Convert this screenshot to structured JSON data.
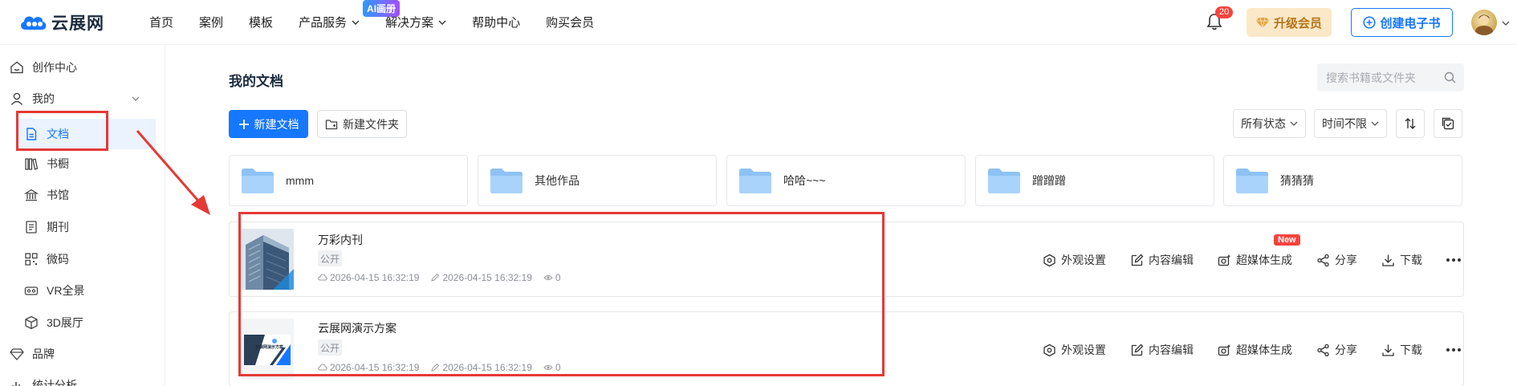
{
  "brand": {
    "name": "云展网"
  },
  "nav": {
    "items": [
      {
        "label": "首页",
        "has_dropdown": false
      },
      {
        "label": "案例",
        "has_dropdown": false
      },
      {
        "label": "模板",
        "has_dropdown": false
      },
      {
        "label": "产品服务",
        "has_dropdown": true
      },
      {
        "label": "解决方案",
        "has_dropdown": true
      },
      {
        "label": "帮助中心",
        "has_dropdown": false
      },
      {
        "label": "购买会员",
        "has_dropdown": false
      }
    ],
    "ai_badge": "AI画册"
  },
  "header": {
    "notification_count": "20",
    "upgrade_label": "升级会员",
    "create_label": "创建电子书"
  },
  "sidebar": {
    "items": [
      {
        "label": "创作中心",
        "icon": "home-icon"
      },
      {
        "label": "我的",
        "icon": "user-icon"
      },
      {
        "label": "文档",
        "icon": "document-icon"
      },
      {
        "label": "书橱",
        "icon": "bookshelf-icon"
      },
      {
        "label": "书馆",
        "icon": "library-icon"
      },
      {
        "label": "期刊",
        "icon": "journal-icon"
      },
      {
        "label": "微码",
        "icon": "qrcode-icon"
      },
      {
        "label": "VR全景",
        "icon": "vr-icon"
      },
      {
        "label": "3D展厅",
        "icon": "cube-icon"
      },
      {
        "label": "品牌",
        "icon": "diamond-icon"
      },
      {
        "label": "统计分析",
        "icon": "chart-icon"
      }
    ]
  },
  "main": {
    "title": "我的文档",
    "search_placeholder": "搜索书籍或文件夹",
    "new_doc_label": "新建文档",
    "new_folder_label": "新建文件夹",
    "status_filter": "所有状态",
    "time_filter": "时间不限",
    "folders": [
      "mmm",
      "其他作品",
      "哈哈~~~",
      "蹭蹭蹭",
      "猜猜猜"
    ],
    "documents": [
      {
        "title": "万彩内刊",
        "tag": "公开",
        "created": "2026-04-15 16:32:19",
        "updated": "2026-04-15 16:32:19",
        "views": "0",
        "thumb_caption": ""
      },
      {
        "title": "云展网演示方案",
        "tag": "公开",
        "created": "2026-04-15 16:32:19",
        "updated": "2026-04-15 16:32:19",
        "views": "0",
        "thumb_caption": "云展网演示方案"
      }
    ],
    "actions": [
      "外观设置",
      "内容编辑",
      "超媒体生成",
      "分享",
      "下载"
    ],
    "new_badge": "New"
  },
  "colors": {
    "accent": "#1677ff",
    "annotation": "#e53935",
    "folder": "#8ec2f4",
    "upgrade_bg": "#fbe8c8",
    "upgrade_text": "#b7741a"
  }
}
